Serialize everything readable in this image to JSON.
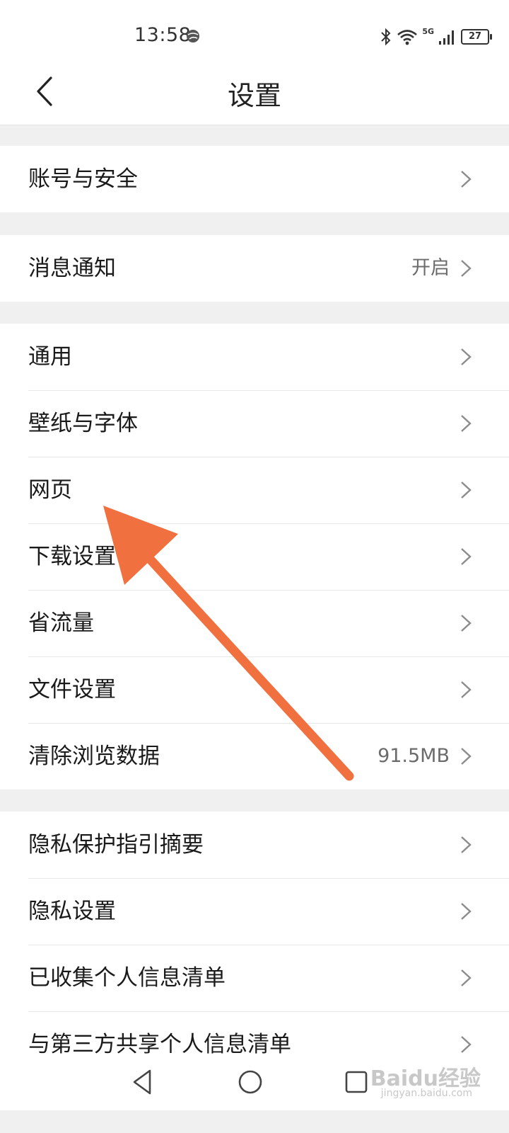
{
  "status_bar": {
    "time": "13:58",
    "network": "5G",
    "battery": "27"
  },
  "header": {
    "title": "设置"
  },
  "groups": [
    {
      "items": [
        {
          "label": "账号与安全"
        }
      ]
    },
    {
      "items": [
        {
          "label": "消息通知",
          "value": "开启"
        }
      ]
    },
    {
      "items": [
        {
          "label": "通用"
        },
        {
          "label": "壁纸与字体"
        },
        {
          "label": "网页"
        },
        {
          "label": "下载设置"
        },
        {
          "label": "省流量"
        },
        {
          "label": "文件设置"
        },
        {
          "label": "清除浏览数据",
          "value": "91.5MB"
        }
      ]
    },
    {
      "items": [
        {
          "label": "隐私保护指引摘要"
        },
        {
          "label": "隐私设置"
        },
        {
          "label": "已收集个人信息清单"
        },
        {
          "label": "与第三方共享个人信息清单"
        }
      ]
    }
  ],
  "watermark": {
    "text": "Baidu经验",
    "sub": "jingyan.baidu.com"
  },
  "colors": {
    "background": "#f0f0f0",
    "surface": "#ffffff",
    "annotation_arrow": "#f07040"
  },
  "icons": [
    "back-chevron-icon",
    "chevron-right-icon",
    "bluetooth-icon",
    "wifi-icon",
    "signal-icon",
    "battery-icon",
    "nav-back-icon",
    "nav-home-icon",
    "nav-recents-icon"
  ]
}
